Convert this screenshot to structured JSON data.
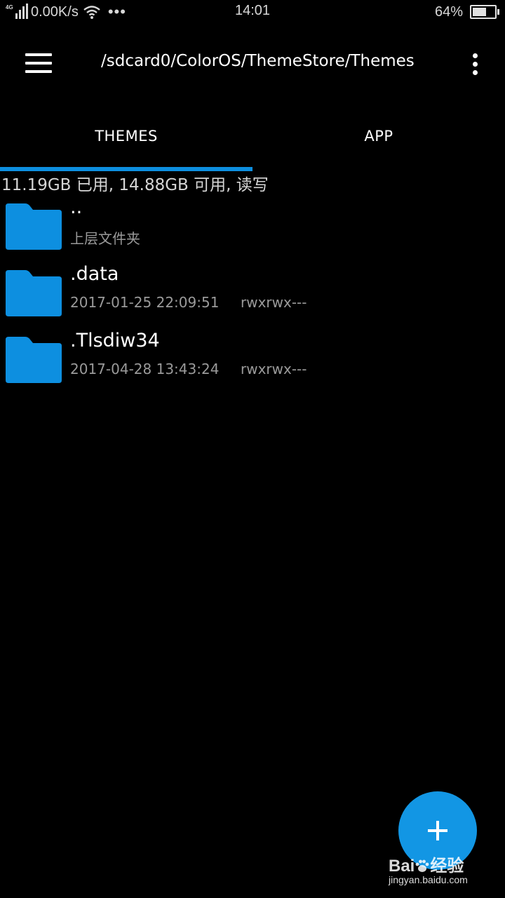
{
  "status_bar": {
    "network_type": "4G",
    "speed": "0.00K/s",
    "more_dots": "•••",
    "time": "14:01",
    "battery_percent": "64%",
    "battery_level": 0.64,
    "icons": [
      "signal-icon",
      "wifi-icon",
      "battery-icon"
    ]
  },
  "toolbar": {
    "path": "/sdcard0/ColorOS/ThemeStore/Themes",
    "icons": [
      "menu-icon",
      "more-vert-icon"
    ]
  },
  "tabs": [
    {
      "label": "THEMES",
      "selected": true
    },
    {
      "label": "APP",
      "selected": false
    }
  ],
  "storage": {
    "info": "11.19GB 已用, 14.88GB 可用, 读写"
  },
  "files": [
    {
      "name": "..",
      "subtitle": "上层文件夹",
      "permissions": ""
    },
    {
      "name": ".data",
      "subtitle": "2017-01-25 22:09:51",
      "permissions": "rwxrwx---"
    },
    {
      "name": ".Tlsdiw34",
      "subtitle": "2017-04-28 13:43:24",
      "permissions": "rwxrwx---"
    }
  ],
  "fab": {
    "icon": "plus-icon"
  },
  "watermark": {
    "logo_left": "Bai",
    "logo_right": "经验",
    "url": "jingyan.baidu.com"
  },
  "colors": {
    "accent": "#1296e4",
    "folder": "#0d8fe0",
    "background": "#000000"
  }
}
